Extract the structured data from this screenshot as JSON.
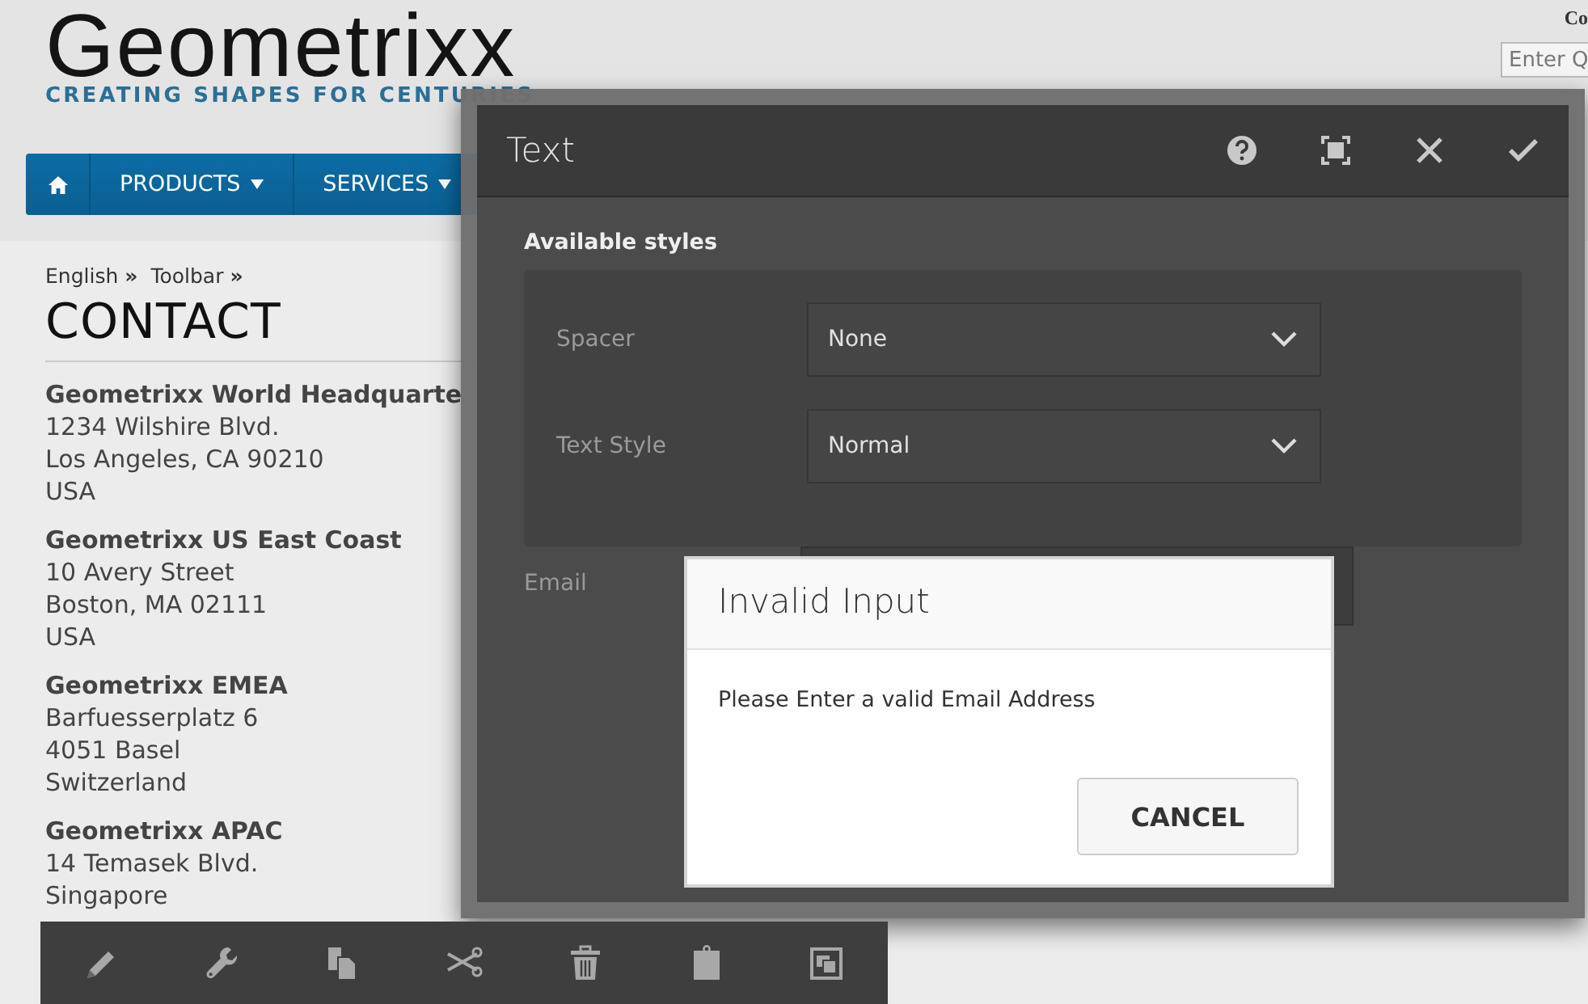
{
  "site": {
    "logo": "Geometrixx",
    "tagline": "CREATING SHAPES FOR CENTURIES",
    "corner_text": "Co",
    "search": {
      "placeholder": "Enter Q"
    },
    "nav": [
      {
        "kind": "home"
      },
      {
        "kind": "menu",
        "label": "PRODUCTS"
      },
      {
        "kind": "menu",
        "label": "SERVICES"
      }
    ],
    "breadcrumb": {
      "separator": "»",
      "items": [
        "English",
        "Toolbar"
      ]
    },
    "heading": "CONTACT",
    "addresses": [
      {
        "name": "Geometrixx World Headquarte",
        "lines": [
          "1234 Wilshire Blvd.",
          "Los Angeles, CA 90210",
          "USA"
        ]
      },
      {
        "name": "Geometrixx US East Coast",
        "lines": [
          "10 Avery Street",
          "Boston, MA 02111",
          "USA"
        ]
      },
      {
        "name": "Geometrixx EMEA",
        "lines": [
          "Barfuesserplatz 6",
          "4051 Basel",
          "Switzerland"
        ]
      },
      {
        "name": "Geometrixx APAC",
        "lines": [
          "14 Temasek Blvd.",
          "Singapore"
        ]
      }
    ]
  },
  "dialog": {
    "title": "Text",
    "actions": [
      {
        "kind": "help"
      },
      {
        "kind": "fullscreen"
      },
      {
        "kind": "close"
      },
      {
        "kind": "done"
      }
    ],
    "section_title": "Available styles",
    "fields": [
      {
        "label": "Spacer",
        "value": "None"
      },
      {
        "label": "Text Style",
        "value": "Normal"
      }
    ],
    "email_label": "Email"
  },
  "alert": {
    "title": "Invalid Input",
    "message": "Please Enter a valid Email Address",
    "button": "CANCEL"
  },
  "toolbar": [
    {
      "kind": "edit"
    },
    {
      "kind": "configure"
    },
    {
      "kind": "copy"
    },
    {
      "kind": "cut"
    },
    {
      "kind": "delete"
    },
    {
      "kind": "paste"
    },
    {
      "kind": "group"
    }
  ]
}
